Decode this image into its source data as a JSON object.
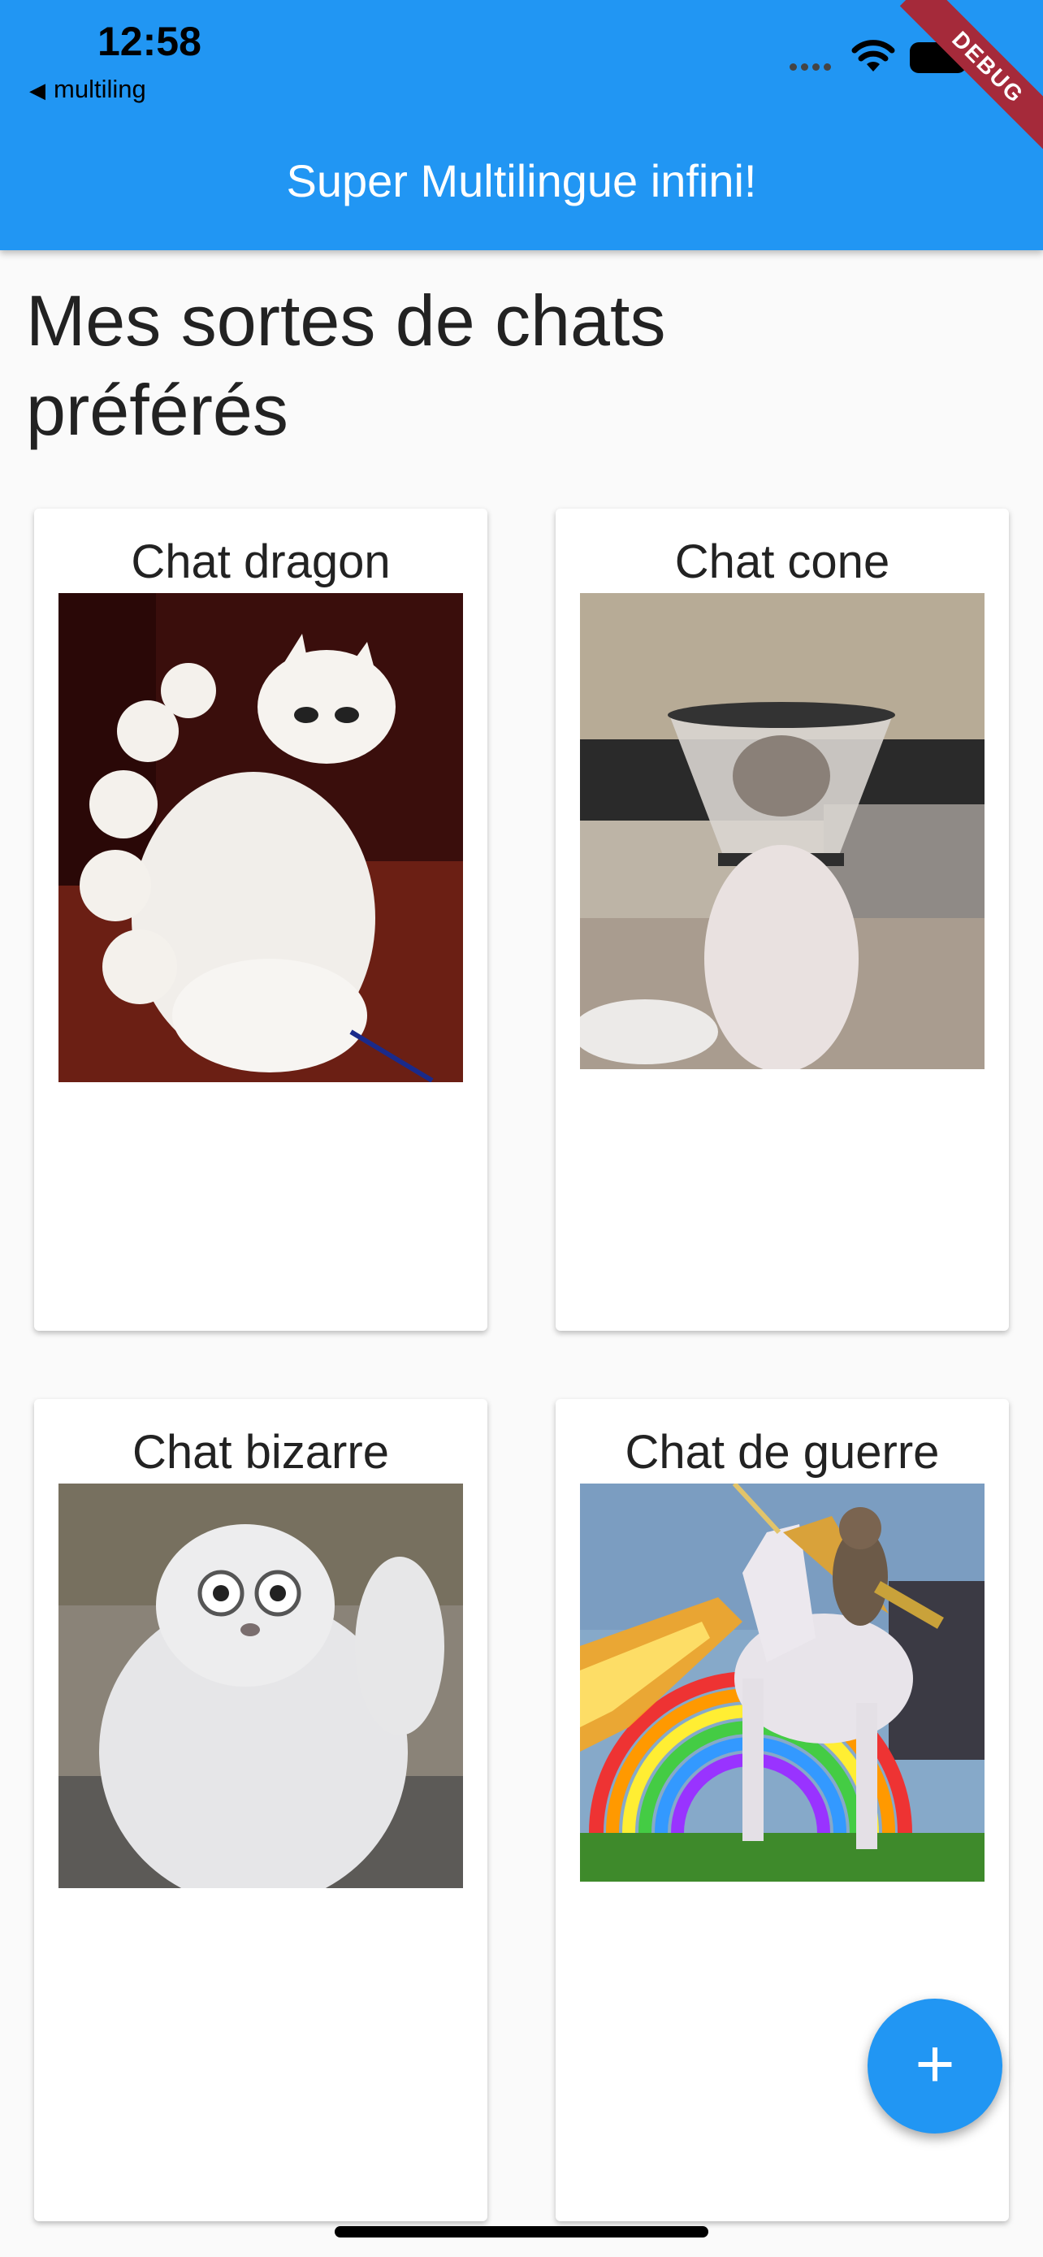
{
  "status_bar": {
    "time": "12:58",
    "back_label": "multiling",
    "back_glyph": "◀"
  },
  "app_bar": {
    "title": "Super Multilingue infini!",
    "debug_banner": "DEBUG"
  },
  "page": {
    "heading": "Mes sortes de chats préférés"
  },
  "cards": [
    {
      "title": "Chat dragon",
      "image_icon": "dragon-cat-photo"
    },
    {
      "title": "Chat cone",
      "image_icon": "cone-cat-photo"
    },
    {
      "title": "Chat bizarre",
      "image_icon": "bizarre-cat-photo"
    },
    {
      "title": "Chat de guerre",
      "image_icon": "war-cat-photo"
    }
  ],
  "fab": {
    "label": "+"
  },
  "colors": {
    "primary": "#2196f3",
    "background": "#fafafa",
    "debug": "#a52a3a"
  }
}
